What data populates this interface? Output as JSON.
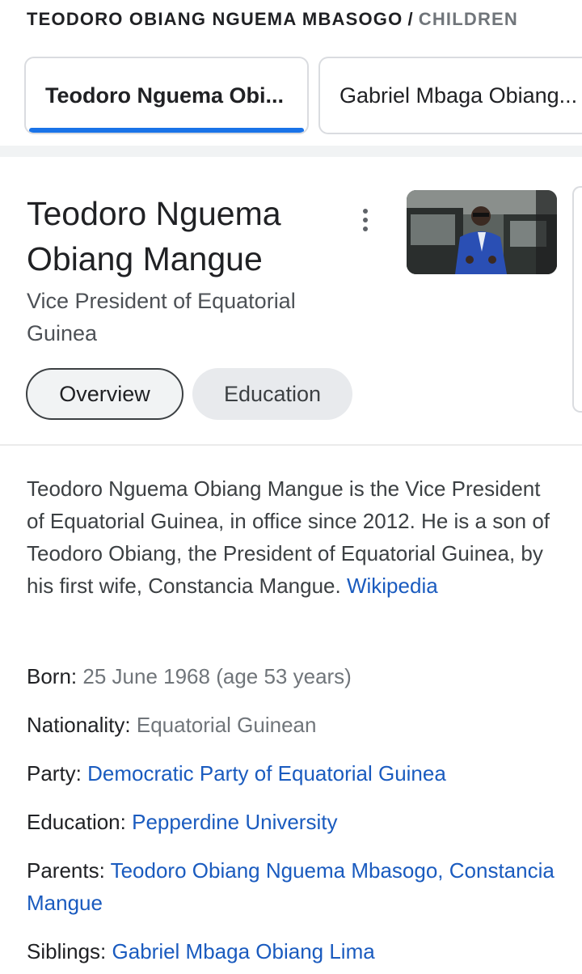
{
  "breadcrumb": {
    "parent": "TEODORO OBIANG NGUEMA MBASOGO",
    "separator": "/",
    "current": "CHILDREN"
  },
  "tabs": [
    {
      "label": "Teodoro Nguema Obi...",
      "selected": true
    },
    {
      "label": "Gabriel Mbaga Obiang...",
      "selected": false
    }
  ],
  "entity": {
    "title": "Teodoro Nguema Obiang Mangue",
    "subtitle": "Vice President of Equatorial Guinea"
  },
  "chips": {
    "overview": "Overview",
    "education": "Education"
  },
  "description": {
    "text": "Teodoro Nguema Obiang Mangue is the Vice President of Equatorial Guinea, in office since 2012. He is a son of Teodoro Obiang, the President of Equatorial Guinea, by his first wife, Constancia Mangue.",
    "source": "Wikipedia"
  },
  "facts": {
    "born": {
      "label": "Born:",
      "value": "25 June 1968 (age 53 years)"
    },
    "nationality": {
      "label": "Nationality:",
      "value": "Equatorial Guinean"
    },
    "party": {
      "label": "Party:",
      "value": "Democratic Party of Equatorial Guinea"
    },
    "education": {
      "label": "Education:",
      "value": "Pepperdine University"
    },
    "parents": {
      "label": "Parents:",
      "value1": "Teodoro Obiang Nguema Mbasogo",
      "separator": ",",
      "value2": "Constancia Mangue"
    },
    "siblings": {
      "label": "Siblings:",
      "value": "Gabriel Mbaga Obiang Lima"
    }
  },
  "colors": {
    "link": "#1a5bbf",
    "accent": "#1a73e8",
    "muted": "#70757a"
  },
  "icons": {
    "more": "more-vert-icon"
  }
}
